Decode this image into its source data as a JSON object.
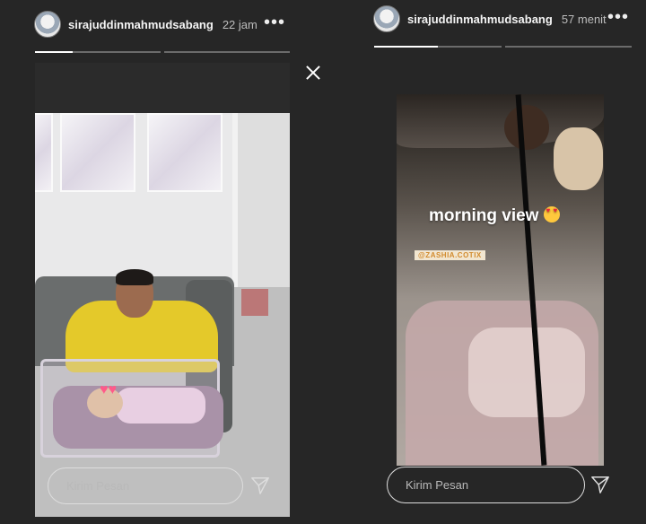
{
  "left_story": {
    "username": "sirajuddinmahmudsabang",
    "time": "22 jam",
    "more_label": "•••",
    "progress": [
      0.3,
      0
    ],
    "reply_placeholder": "Kirim Pesan",
    "sticker_icon": "heart-sticker-icon"
  },
  "right_story": {
    "username": "sirajuddinmahmudsabang",
    "time": "57 menit",
    "more_label": "•••",
    "progress": [
      0.5,
      0
    ],
    "caption": "morning view",
    "mention": "@ZASHIA.COTIX",
    "reply_placeholder": "Kirim Pesan"
  },
  "icons": {
    "close": "close-icon",
    "send": "send-icon",
    "more": "more-options-icon",
    "avatar": "avatar"
  },
  "colors": {
    "background": "#262626",
    "progress_fill": "#ffffff",
    "progress_track": "#6b6b6b"
  }
}
